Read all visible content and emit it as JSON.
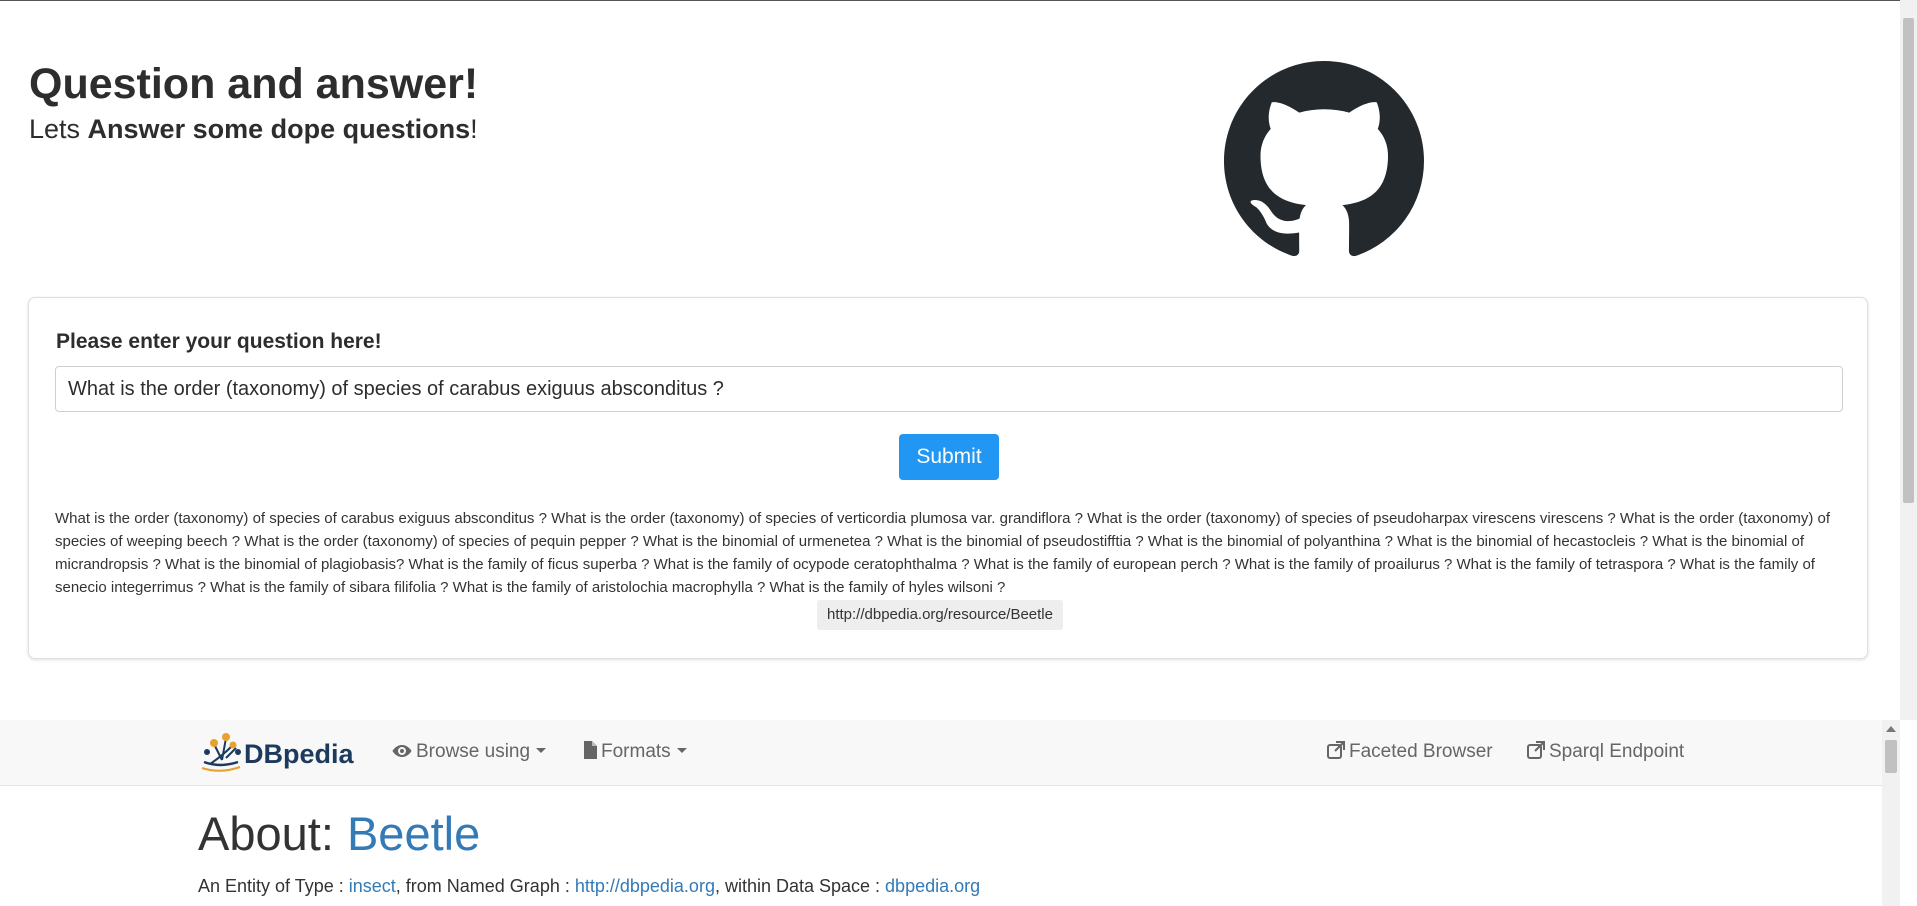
{
  "hero": {
    "title": "Question and answer!",
    "subtitle_prefix": "Lets ",
    "subtitle_bold": "Answer some dope questions",
    "subtitle_suffix": "!"
  },
  "form": {
    "label": "Please enter your question here!",
    "input_value": "What is the order (taxonomy) of species of carabus exiguus absconditus ?",
    "submit_label": "Submit",
    "examples_text": "What is the order (taxonomy) of species of carabus exiguus absconditus ? What is the order (taxonomy) of species of verticordia plumosa var. grandiflora ? What is the order (taxonomy) of species of pseudoharpax virescens virescens ? What is the order (taxonomy) of species of weeping beech ? What is the order (taxonomy) of species of pequin pepper ? What is the binomial of urmenetea ? What is the binomial of pseudostifftia ? What is the binomial of polyanthina ? What is the binomial of hecastocleis ? What is the binomial of micrandropsis ? What is the binomial of plagiobasis? What is the family of ficus superba ? What is the family of ocypode ceratophthalma ? What is the family of european perch ? What is the family of proailurus ? What is the family of tetraspora ? What is the family of senecio integerrimus ? What is the family of sibara filifolia ? What is the family of aristolochia macrophylla ? What is the family of hyles wilsoni ?",
    "result_url": "http://dbpedia.org/resource/Beetle"
  },
  "dbpedia": {
    "logo_text": "DBpedia",
    "nav": {
      "browse_label": "Browse using",
      "formats_label": "Formats",
      "faceted_label": "Faceted Browser",
      "sparql_label": "Sparql Endpoint"
    },
    "about_prefix": "About: ",
    "about_entity": "Beetle",
    "entity_prefix": "An Entity of Type : ",
    "entity_type": "insect",
    "graph_prefix": ", from Named Graph : ",
    "graph_link": "http://dbpedia.org",
    "space_prefix": ", within Data Space : ",
    "space_link": "dbpedia.org"
  },
  "colors": {
    "primary_button": "#2196f3",
    "link": "#337ab7",
    "github_logo": "#24292e",
    "dbpedia_blue": "#1b3a5c",
    "dbpedia_orange": "#e8a12d"
  },
  "icons": [
    "github-logo-icon",
    "eye-icon",
    "file-icon",
    "external-link-icon",
    "caret-down-icon"
  ]
}
